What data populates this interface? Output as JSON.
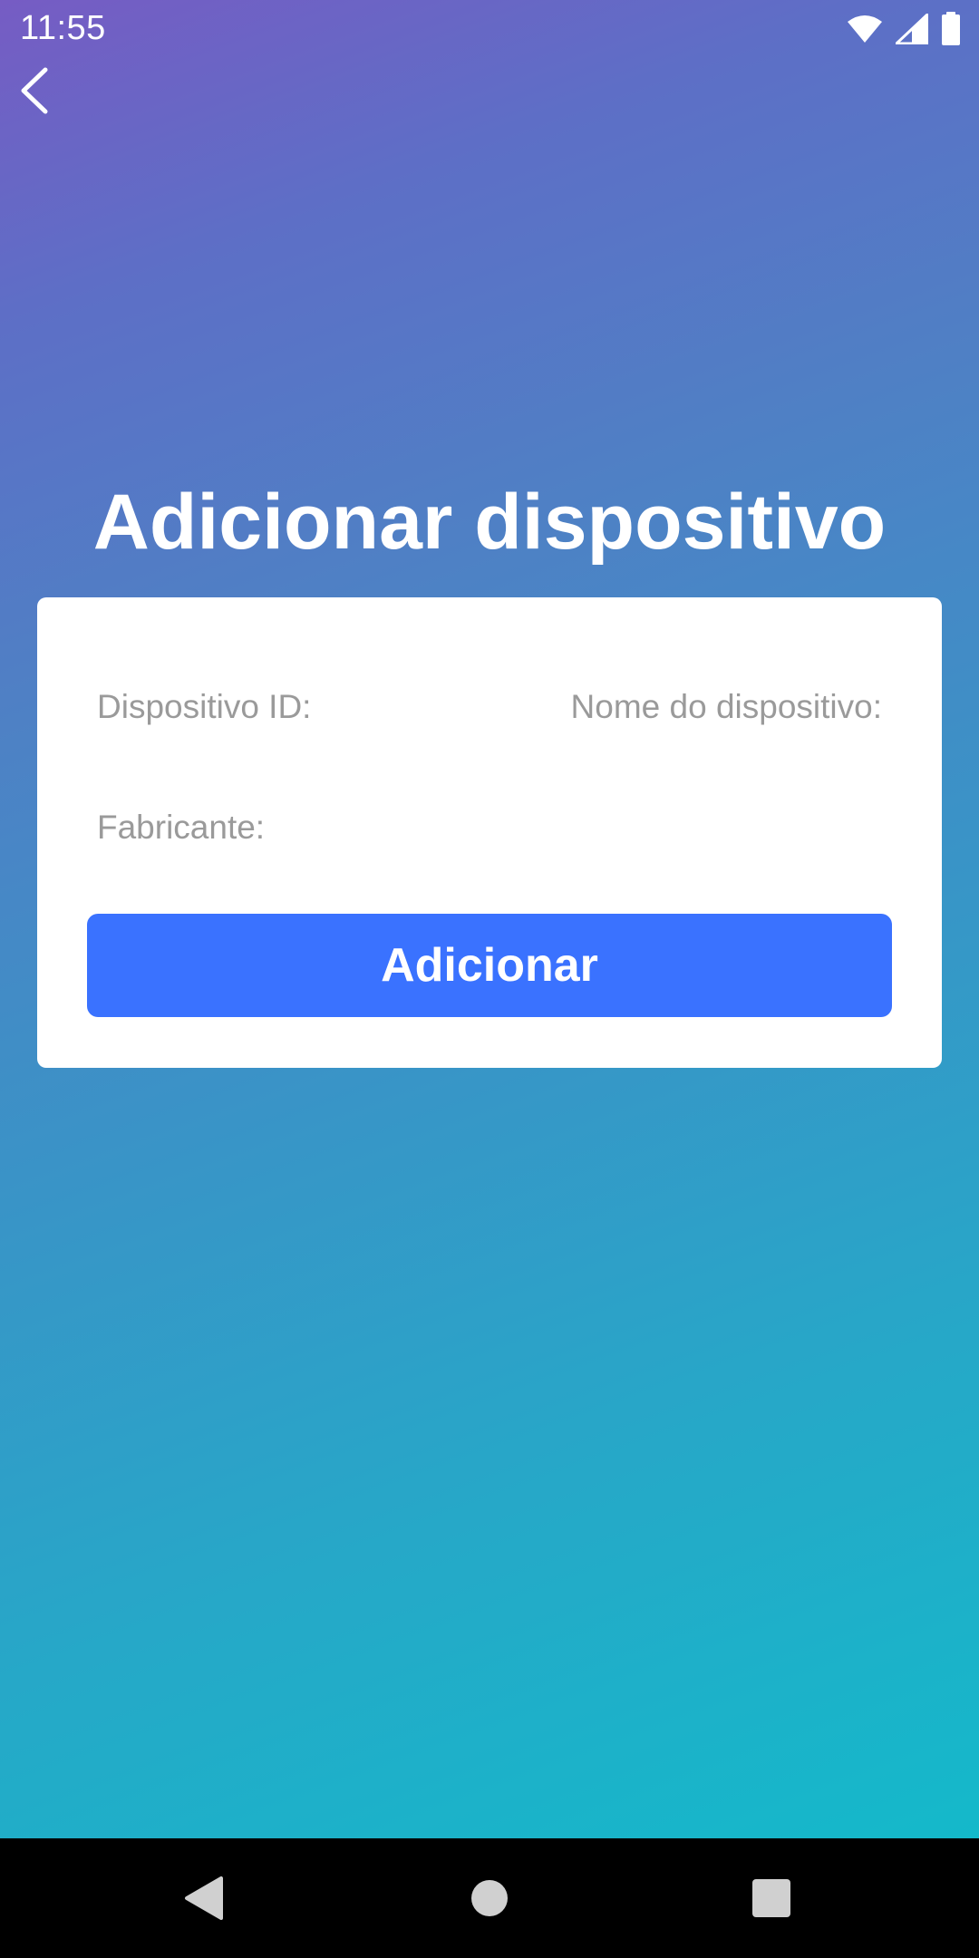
{
  "status_bar": {
    "time": "11:55",
    "icons": [
      "wifi-icon",
      "signal-icon",
      "battery-icon"
    ]
  },
  "header": {
    "back_icon": "chevron-left-icon"
  },
  "page": {
    "title": "Adicionar dispositivo"
  },
  "form": {
    "device_id_label": "Dispositivo ID:",
    "device_name_label": "Nome do dispositivo:",
    "manufacturer_label": "Fabricante:",
    "submit_label": "Adicionar"
  },
  "nav_bar": {
    "buttons": [
      "nav-back-icon",
      "nav-home-icon",
      "nav-recents-icon"
    ]
  },
  "colors": {
    "gradient_top": "#765cc4",
    "gradient_bottom": "#14b9ca",
    "primary_button": "#3a72ff",
    "label_text": "#9a9a9a"
  }
}
